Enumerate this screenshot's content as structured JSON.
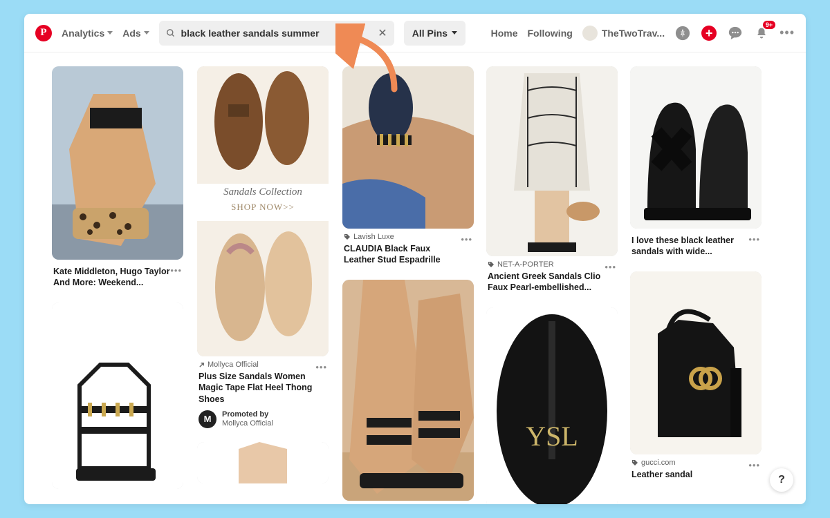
{
  "header": {
    "nav": {
      "analytics": "Analytics",
      "ads": "Ads"
    },
    "search": {
      "value": "black leather sandals summer",
      "placeholder": "Search"
    },
    "filter": "All Pins",
    "links": {
      "home": "Home",
      "following": "Following",
      "profile": "TheTwoTrav..."
    },
    "badge": "9+"
  },
  "pins": {
    "p1": {
      "title": "Kate Middleton, Hugo Taylor And More: Weekend..."
    },
    "p2": {
      "source": "Mollyca Official",
      "title": "Plus Size Sandals Women Magic Tape Flat Heel Thong Shoes",
      "promo_label": "Promoted by",
      "promoter": "Mollyca Official",
      "banner_top": "Sandals Collection",
      "banner_bottom": "SHOP NOW>>"
    },
    "p3": {
      "source": "Lavish Luxe",
      "title": "CLAUDIA Black Faux Leather Stud Espadrille"
    },
    "p4": {
      "source": "NET-A-PORTER",
      "title": "Ancient Greek Sandals Clio Faux Pearl-embellished..."
    },
    "p5": {
      "title": "I love these black leather sandals with wide..."
    },
    "p6": {
      "source": "gucci.com",
      "title": "Leather sandal"
    }
  },
  "help": "?"
}
